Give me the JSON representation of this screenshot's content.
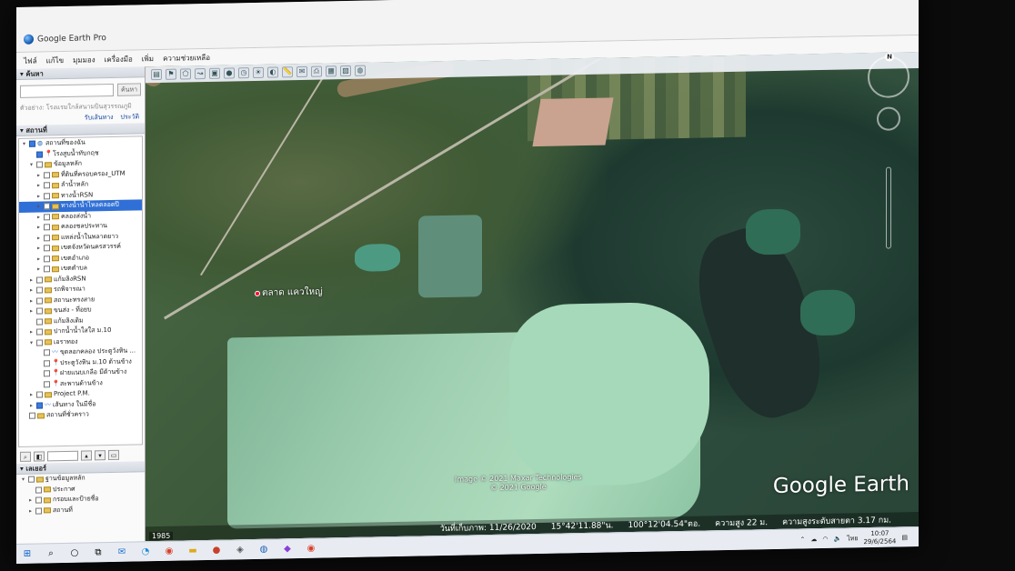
{
  "window": {
    "title": "Google Earth Pro"
  },
  "menu": [
    "ไฟล์",
    "แก้ไข",
    "มุมมอง",
    "เครื่องมือ",
    "เพิ่ม",
    "ความช่วยเหลือ"
  ],
  "search": {
    "header": "▾ ค้นหา",
    "button": "ค้นหา",
    "hint": "ตัวอย่าง: โรงแรมใกล้สนามบินสุวรรณภูมิ",
    "link_directions": "รับเส้นทาง",
    "link_history": "ประวัติ"
  },
  "places": {
    "header": "▾ สถานที่",
    "items": [
      {
        "label": "สถานที่ของฉัน",
        "level": 0,
        "checked": true,
        "type": "globe",
        "expand": "▾"
      },
      {
        "label": "โรงสูบน้ำทับกฤช",
        "level": 1,
        "checked": true,
        "type": "pin",
        "expand": ""
      },
      {
        "label": "ข้อมูลหลัก",
        "level": 1,
        "checked": false,
        "type": "folder",
        "expand": "▾"
      },
      {
        "label": "ที่ดินที่ครอบครอง_UTM",
        "level": 2,
        "checked": false,
        "type": "folder",
        "expand": "▸"
      },
      {
        "label": "ลำน้ำหลัก",
        "level": 2,
        "checked": false,
        "type": "folder",
        "expand": "▸"
      },
      {
        "label": "ทางน้ำRSN",
        "level": 2,
        "checked": false,
        "type": "folder",
        "expand": "▸"
      },
      {
        "label": "ทางน้ำน้ำไหลตลอดปี",
        "level": 2,
        "checked": false,
        "type": "folder",
        "expand": "▸",
        "selected": true
      },
      {
        "label": "คลองส่งน้ำ",
        "level": 2,
        "checked": false,
        "type": "folder",
        "expand": "▸"
      },
      {
        "label": "คลองชลประทาน",
        "level": 2,
        "checked": false,
        "type": "folder",
        "expand": "▸"
      },
      {
        "label": "แหล่งน้ำในพลาดยาว",
        "level": 2,
        "checked": false,
        "type": "folder",
        "expand": "▸"
      },
      {
        "label": "เขตจังหวัดนครสวรรค์",
        "level": 2,
        "checked": false,
        "type": "folder",
        "expand": "▸"
      },
      {
        "label": "เขตอำเภอ",
        "level": 2,
        "checked": false,
        "type": "folder",
        "expand": "▸"
      },
      {
        "label": "เขตตำบล",
        "level": 2,
        "checked": false,
        "type": "folder",
        "expand": "▸"
      },
      {
        "label": "แก้มลิงRSN",
        "level": 1,
        "checked": false,
        "type": "folder",
        "expand": "▸"
      },
      {
        "label": "รถพิจารณา",
        "level": 1,
        "checked": false,
        "type": "folder",
        "expand": "▸"
      },
      {
        "label": "สถานะทรงสาย",
        "level": 1,
        "checked": false,
        "type": "folder",
        "expand": "▸"
      },
      {
        "label": "ขนส่ง - ที่อยบ",
        "level": 1,
        "checked": false,
        "type": "folder",
        "expand": "▸"
      },
      {
        "label": "แก้มลิงเดิม",
        "level": 1,
        "checked": false,
        "type": "folder",
        "expand": ""
      },
      {
        "label": "ปากน้ำน้ำใสใส ม.10",
        "level": 1,
        "checked": false,
        "type": "folder",
        "expand": "▸"
      },
      {
        "label": "เอราทอง",
        "level": 1,
        "checked": false,
        "type": "folder",
        "expand": "▾"
      },
      {
        "label": "ขุดลอกคลอง ประตูวังหิน ...",
        "level": 2,
        "checked": false,
        "type": "path",
        "expand": ""
      },
      {
        "label": "ประตูวังหิน ม.10 ด้านข้าง",
        "level": 2,
        "checked": false,
        "type": "pin",
        "expand": ""
      },
      {
        "label": "ฝายแนบเกลือ มีด้านข้าง",
        "level": 2,
        "checked": false,
        "type": "pin",
        "expand": ""
      },
      {
        "label": "สะพานด้านข้าง",
        "level": 2,
        "checked": false,
        "type": "pin",
        "expand": ""
      },
      {
        "label": "Project P.M.",
        "level": 1,
        "checked": false,
        "type": "folder",
        "expand": "▸"
      },
      {
        "label": "เส้นทาง ในมีชื่อ",
        "level": 1,
        "checked": true,
        "type": "path",
        "expand": "▸"
      },
      {
        "label": "สถานที่ชั่วคราว",
        "level": 0,
        "checked": false,
        "type": "folder",
        "expand": ""
      }
    ]
  },
  "layers": {
    "header": "▾ เลเยอร์",
    "items": [
      {
        "label": "ฐานข้อมูลหลัก",
        "checked": false,
        "expand": "▾"
      },
      {
        "label": "ประกาศ",
        "checked": false,
        "expand": ""
      },
      {
        "label": "กรอบและป้ายชื่อ",
        "checked": false,
        "expand": "▸"
      },
      {
        "label": "สถานที่",
        "checked": false,
        "expand": "▸"
      }
    ]
  },
  "map": {
    "place_label": "ตลาด แควใหญ่",
    "attribution_1": "Image © 2021 Maxar Technologies",
    "attribution_2": "© 2021 Google",
    "logo": "Google Earth",
    "year": "1985",
    "compass_n": "N"
  },
  "status": {
    "date": "วันที่เก็บภาพ: 11/26/2020",
    "lat": "15°42'11.88\"น.",
    "lon": "100°12'04.54\"ตอ.",
    "elev": "ความสูง   22 ม.",
    "eye": "ความสูงระดับสายตา   3.17 กม."
  },
  "taskbar": {
    "time": "10:07",
    "date": "29/6/2564",
    "lang": "ไทย"
  }
}
